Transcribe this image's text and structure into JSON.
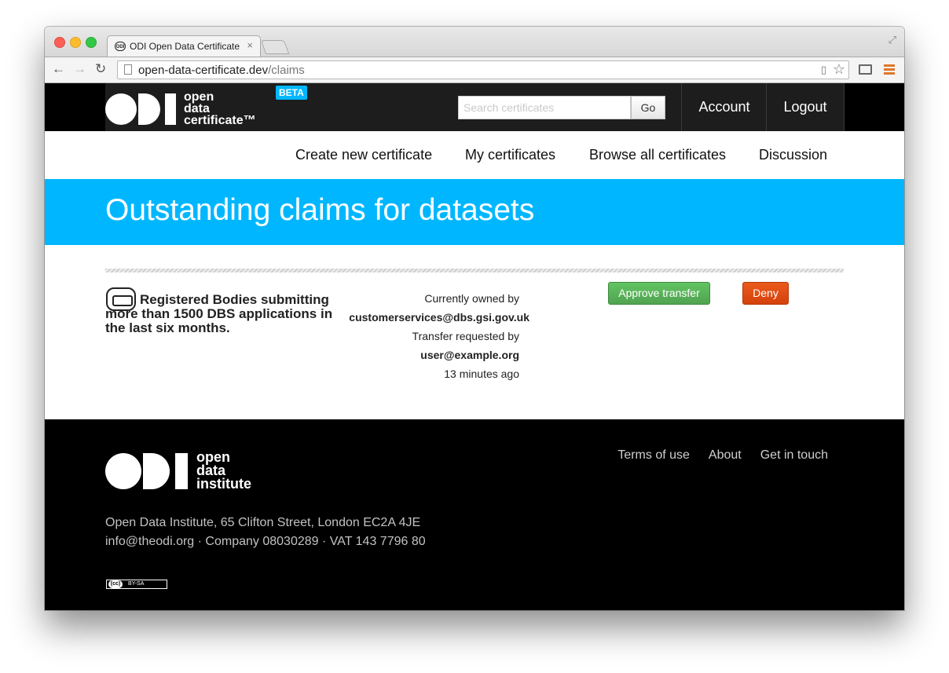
{
  "browser": {
    "tab_title": "ODI Open Data Certificate",
    "tab_close": "×",
    "tab_favicon": "ODI",
    "url_host": "open-data-certificate.dev",
    "url_path": "/claims",
    "icons": [
      "back-arrow-icon",
      "forward-arrow-icon",
      "reload-icon",
      "page-icon",
      "star-icon",
      "cast-icon",
      "menu-icon"
    ]
  },
  "header": {
    "logo_lines": [
      "open",
      "data",
      "certificate™"
    ],
    "beta_label": "BETA",
    "search_placeholder": "Search certificates",
    "search_button": "Go",
    "account_label": "Account",
    "logout_label": "Logout"
  },
  "subnav": {
    "items": [
      "Create new certificate",
      "My certificates",
      "Browse all certificates",
      "Discussion"
    ]
  },
  "banner": {
    "title": "Outstanding claims for datasets"
  },
  "claim": {
    "dataset_title": "Registered Bodies submitting more than 1500 DBS applications in the last six months.",
    "owned_label": "Currently owned by",
    "owner_email": "customerservices@dbs.gsi.gov.uk",
    "requested_label": "Transfer requested by",
    "requester_email": "user@example.org",
    "time_ago": "13 minutes ago",
    "approve_label": "Approve transfer",
    "deny_label": "Deny",
    "colors": {
      "approve": "#51a351",
      "deny": "#d4420c"
    }
  },
  "footer": {
    "logo_lines": [
      "open",
      "data",
      "institute"
    ],
    "links": [
      "Terms of use",
      "About",
      "Get in touch"
    ],
    "address_line1": "Open Data Institute, 65 Clifton Street, London EC2A 4JE",
    "address_line2": "info@theodi.org · Company 08030289 · VAT 143 7796 80",
    "license_cc": "(cc)",
    "license_label": "BY-SA"
  },
  "colors": {
    "accent": "#00b7ff",
    "header_bg": "#1d1d1d",
    "footer_bg": "#000000"
  }
}
